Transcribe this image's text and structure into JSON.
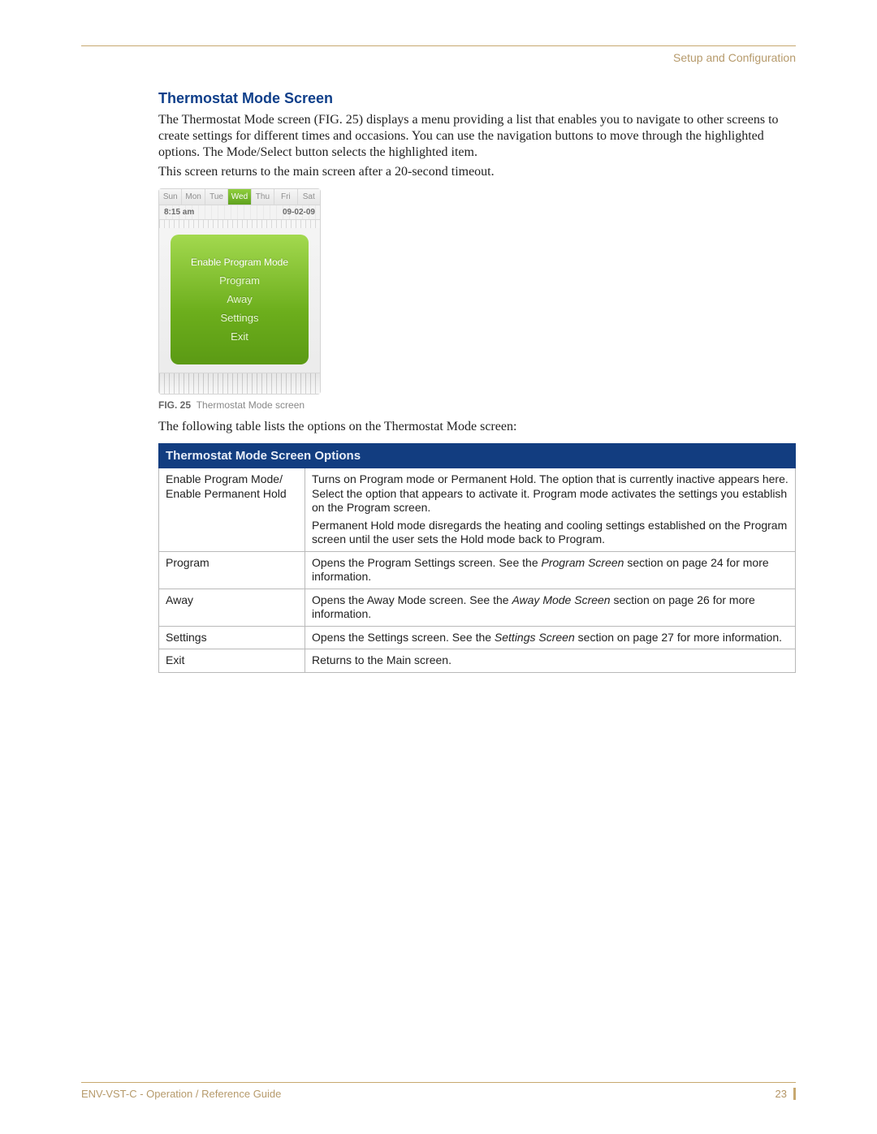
{
  "header": {
    "breadcrumb": "Setup and Configuration"
  },
  "section": {
    "title": "Thermostat Mode Screen",
    "p1": "The Thermostat Mode screen (FIG. 25) displays a menu providing a list that enables you to navigate to other screens to create settings for different times and occasions. You can use the navigation buttons to move through the highlighted options. The Mode/Select button selects the highlighted item.",
    "p2": "This screen returns to the main screen after a 20-second timeout."
  },
  "thermo": {
    "days": [
      "Sun",
      "Mon",
      "Tue",
      "Wed",
      "Thu",
      "Fri",
      "Sat"
    ],
    "active_day_index": 3,
    "time": "8:15 am",
    "date": "09-02-09",
    "menu": [
      "Enable Program Mode",
      "Program",
      "Away",
      "Settings",
      "Exit"
    ]
  },
  "figure": {
    "label": "FIG. 25",
    "caption": "Thermostat Mode screen"
  },
  "table_intro": "The following table lists the options on the Thermostat Mode screen:",
  "table": {
    "header": "Thermostat Mode Screen Options",
    "rows": [
      {
        "option_lines": [
          "Enable Program Mode/",
          "Enable Permanent Hold"
        ],
        "desc": [
          "Turns on Program mode or Permanent Hold. The option that is currently inactive appears here. Select the option that appears to activate it. Program mode activates the settings you establish on the Program screen.",
          "Permanent Hold mode disregards the heating and cooling settings established on the Program screen until the user sets the Hold mode back to Program."
        ]
      },
      {
        "option_lines": [
          "Program"
        ],
        "desc_parts": [
          {
            "t": "Opens the Program Settings screen. See the "
          },
          {
            "t": "Program Screen",
            "i": true
          },
          {
            "t": " section on page 24 for more information."
          }
        ]
      },
      {
        "option_lines": [
          "Away"
        ],
        "desc_parts": [
          {
            "t": "Opens the Away Mode screen. See the "
          },
          {
            "t": "Away Mode Screen",
            "i": true
          },
          {
            "t": " section on page 26 for more information."
          }
        ]
      },
      {
        "option_lines": [
          "Settings"
        ],
        "desc_parts": [
          {
            "t": "Opens the Settings screen. See the "
          },
          {
            "t": "Settings Screen",
            "i": true
          },
          {
            "t": " section on page 27 for more information."
          }
        ]
      },
      {
        "option_lines": [
          "Exit"
        ],
        "desc": [
          "Returns to the Main screen."
        ]
      }
    ]
  },
  "footer": {
    "left": "ENV-VST-C - Operation / Reference Guide",
    "page": "23"
  }
}
